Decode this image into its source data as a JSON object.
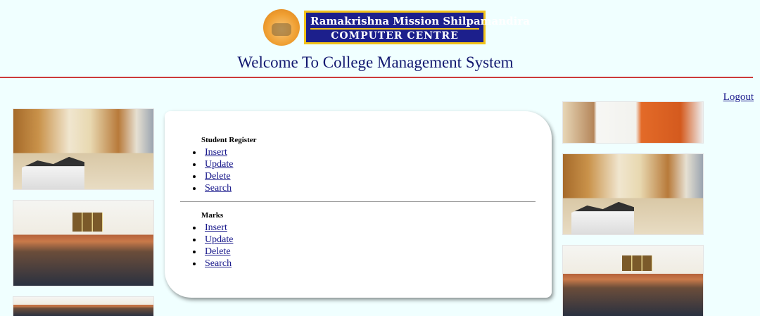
{
  "header": {
    "logo_line1": "Ramakrishna Mission Shilpamandira",
    "logo_line2": "COMPUTER CENTRE",
    "title": "Welcome To College Management System",
    "logout_label": "Logout"
  },
  "menu": {
    "student_register": {
      "title": "Student Register",
      "items": [
        "Insert",
        "Update",
        "Delete",
        "Search"
      ]
    },
    "marks": {
      "title": "Marks",
      "items": [
        "Insert",
        "Update",
        "Delete",
        "Search"
      ]
    }
  },
  "colors": {
    "background": "#f0ffff",
    "title": "#121870",
    "rule": "#cc3a3a",
    "logo_bg": "#1c1f8c",
    "logo_border": "#f2c21a",
    "link": "#1a1a8c"
  },
  "icons": {
    "emblem": "mission-emblem-icon"
  }
}
